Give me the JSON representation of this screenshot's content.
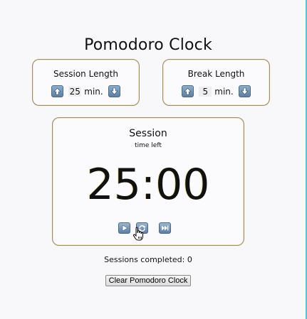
{
  "app": {
    "title": "Pomodoro Clock"
  },
  "session_setting": {
    "label": "Session Length",
    "value": "25",
    "unit": "min."
  },
  "break_setting": {
    "label": "Break Length",
    "value": "5",
    "unit": "min."
  },
  "timer": {
    "label": "Session",
    "sublabel": "time left",
    "display": "25:00"
  },
  "footer": {
    "sessions_completed": "Sessions completed: 0",
    "clear_button": "Clear Pomodoro Clock"
  },
  "icons": {
    "increment": "up-arrow-icon",
    "decrement": "down-arrow-icon",
    "play": "play-icon",
    "reset": "refresh-icon",
    "skip": "skip-forward-icon"
  },
  "colors": {
    "box_border": "#a08c68",
    "button_blue": "#5c7fa2",
    "accent_cyan": "#46c7ea"
  }
}
